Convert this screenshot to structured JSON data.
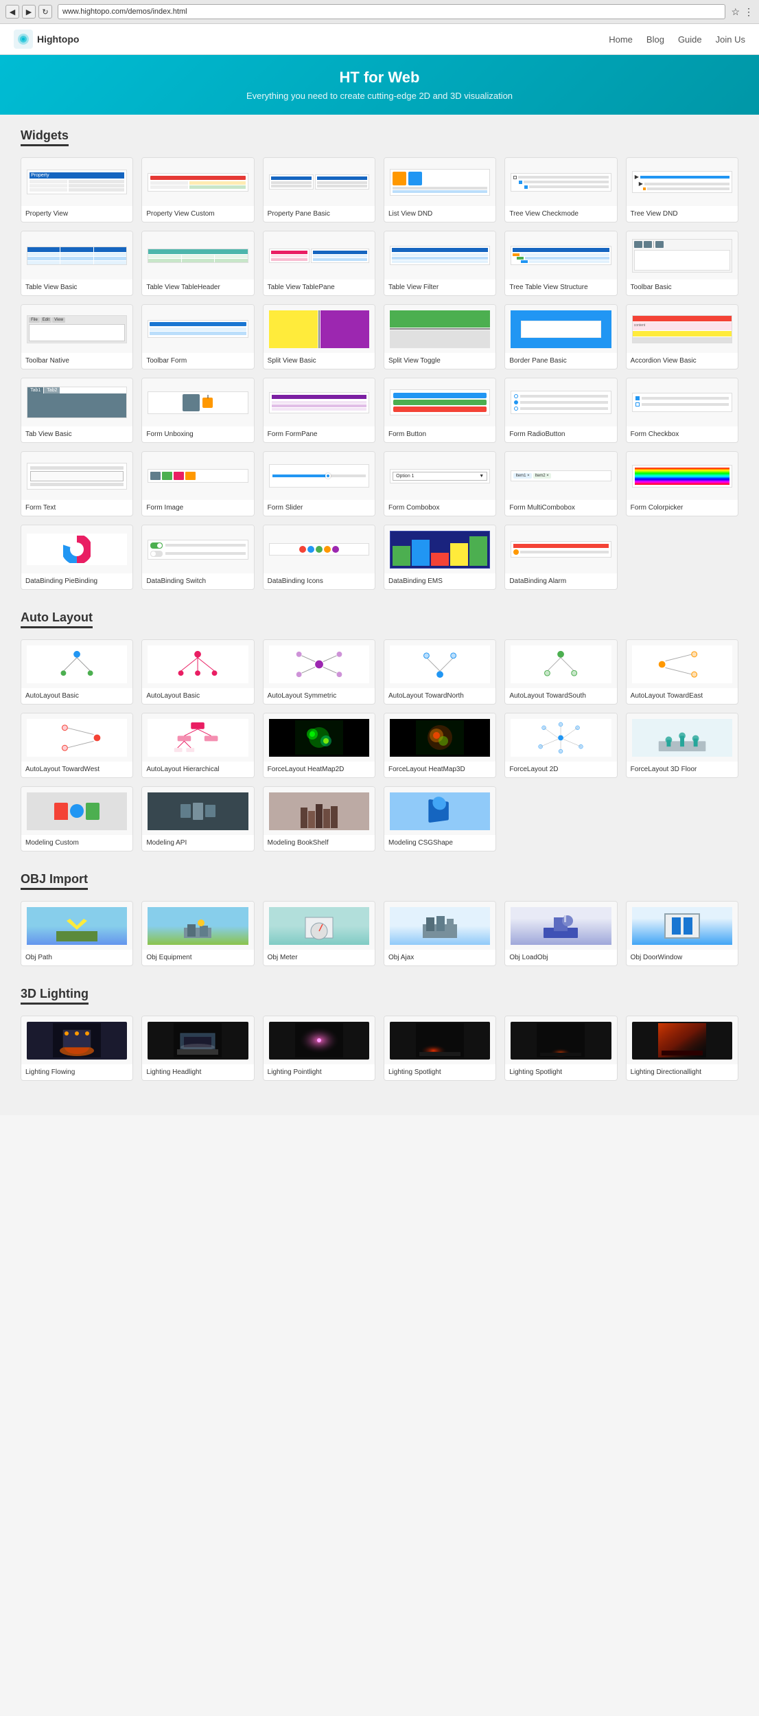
{
  "browser": {
    "url": "www.hightopo.com/demos/index.html",
    "back_label": "◀",
    "forward_label": "▶",
    "refresh_label": "↻",
    "star_label": "☆",
    "menu_label": "⋮"
  },
  "topnav": {
    "logo_text": "Hightopo",
    "links": [
      "Home",
      "Blog",
      "Guide",
      "Join Us"
    ]
  },
  "hero": {
    "title": "HT for Web",
    "subtitle": "Everything you need to create cutting-edge 2D and 3D visualization"
  },
  "sections": [
    {
      "title": "Widgets",
      "items": [
        {
          "label": "Property View",
          "thumb_type": "property"
        },
        {
          "label": "Property View Custom",
          "thumb_type": "property_custom"
        },
        {
          "label": "Property Pane Basic",
          "thumb_type": "property_pane"
        },
        {
          "label": "List View DND",
          "thumb_type": "list_dnd"
        },
        {
          "label": "Tree View Checkmode",
          "thumb_type": "tree_check"
        },
        {
          "label": "Tree View DND",
          "thumb_type": "tree_dnd"
        },
        {
          "label": "Table View Basic",
          "thumb_type": "table_basic"
        },
        {
          "label": "Table View TableHeader",
          "thumb_type": "table_header"
        },
        {
          "label": "Table View TablePane",
          "thumb_type": "table_pane"
        },
        {
          "label": "Table View Filter",
          "thumb_type": "table_filter"
        },
        {
          "label": "Tree Table View Structure",
          "thumb_type": "tree_table"
        },
        {
          "label": "Toolbar Basic",
          "thumb_type": "toolbar_basic"
        },
        {
          "label": "Toolbar Native",
          "thumb_type": "toolbar_native"
        },
        {
          "label": "Toolbar Form",
          "thumb_type": "toolbar_form"
        },
        {
          "label": "Split View Basic",
          "thumb_type": "split_basic"
        },
        {
          "label": "Split View Toggle",
          "thumb_type": "split_toggle"
        },
        {
          "label": "Border Pane Basic",
          "thumb_type": "border_pane"
        },
        {
          "label": "Accordion View Basic",
          "thumb_type": "accordion"
        },
        {
          "label": "Tab View Basic",
          "thumb_type": "tab_view"
        },
        {
          "label": "Form Unboxing",
          "thumb_type": "form_unboxing"
        },
        {
          "label": "Form FormPane",
          "thumb_type": "form_pane"
        },
        {
          "label": "Form Button",
          "thumb_type": "form_button"
        },
        {
          "label": "Form RadioButton",
          "thumb_type": "form_radio"
        },
        {
          "label": "Form Checkbox",
          "thumb_type": "form_checkbox"
        },
        {
          "label": "Form Text",
          "thumb_type": "form_text"
        },
        {
          "label": "Form Image",
          "thumb_type": "form_image"
        },
        {
          "label": "Form Slider",
          "thumb_type": "form_slider"
        },
        {
          "label": "Form Combobox",
          "thumb_type": "form_combobox"
        },
        {
          "label": "Form MultiCombobox",
          "thumb_type": "form_multicombo"
        },
        {
          "label": "Form Colorpicker",
          "thumb_type": "form_colorpicker"
        },
        {
          "label": "DataBinding PieBinding",
          "thumb_type": "db_pie"
        },
        {
          "label": "DataBinding Switch",
          "thumb_type": "db_switch"
        },
        {
          "label": "DataBinding Icons",
          "thumb_type": "db_icons"
        },
        {
          "label": "DataBinding EMS",
          "thumb_type": "db_ems"
        },
        {
          "label": "DataBinding Alarm",
          "thumb_type": "db_alarm"
        }
      ]
    },
    {
      "title": "Auto Layout",
      "items": [
        {
          "label": "AutoLayout Basic",
          "thumb_type": "al_basic"
        },
        {
          "label": "AutoLayout Basic",
          "thumb_type": "al_basic2"
        },
        {
          "label": "AutoLayout Symmetric",
          "thumb_type": "al_symmetric"
        },
        {
          "label": "AutoLayout TowardNorth",
          "thumb_type": "al_north"
        },
        {
          "label": "AutoLayout TowardSouth",
          "thumb_type": "al_south"
        },
        {
          "label": "AutoLayout TowardEast",
          "thumb_type": "al_east"
        },
        {
          "label": "AutoLayout TowardWest",
          "thumb_type": "al_west"
        },
        {
          "label": "AutoLayout Hierarchical",
          "thumb_type": "al_hierarchical"
        },
        {
          "label": "ForceLayout HeatMap2D",
          "thumb_type": "fl_heatmap2d"
        },
        {
          "label": "ForceLayout HeatMap3D",
          "thumb_type": "fl_heatmap3d"
        },
        {
          "label": "ForceLayout 2D",
          "thumb_type": "fl_2d"
        },
        {
          "label": "ForceLayout 3D Floor",
          "thumb_type": "fl_3d"
        },
        {
          "label": "Modeling Custom",
          "thumb_type": "modeling_custom"
        },
        {
          "label": "Modeling API",
          "thumb_type": "modeling_api"
        },
        {
          "label": "Modeling BookShelf",
          "thumb_type": "modeling_bookshelf"
        },
        {
          "label": "Modeling CSGShape",
          "thumb_type": "modeling_csg"
        }
      ]
    },
    {
      "title": "OBJ Import",
      "items": [
        {
          "label": "Obj Path",
          "thumb_type": "obj_path"
        },
        {
          "label": "Obj Equipment",
          "thumb_type": "obj_equipment"
        },
        {
          "label": "Obj Meter",
          "thumb_type": "obj_meter"
        },
        {
          "label": "Obj Ajax",
          "thumb_type": "obj_ajax"
        },
        {
          "label": "Obj LoadObj",
          "thumb_type": "obj_load"
        },
        {
          "label": "Obj DoorWindow",
          "thumb_type": "obj_door"
        }
      ]
    },
    {
      "title": "3D Lighting",
      "items": [
        {
          "label": "Lighting Flowing",
          "thumb_type": "light_flowing"
        },
        {
          "label": "Lighting Headlight",
          "thumb_type": "light_headlight"
        },
        {
          "label": "Lighting Pointlight",
          "thumb_type": "light_pointlight"
        },
        {
          "label": "Lighting Spotlight",
          "thumb_type": "light_spotlight1"
        },
        {
          "label": "Lighting Spotlight",
          "thumb_type": "light_spotlight2"
        },
        {
          "label": "Lighting Directionallight",
          "thumb_type": "light_directional"
        }
      ]
    }
  ]
}
